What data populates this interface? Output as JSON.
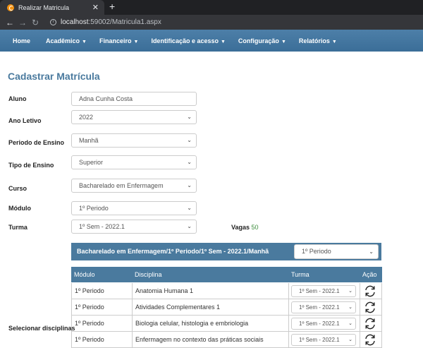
{
  "browser": {
    "tab_title": "Realizar Matricula",
    "url_host": "localhost",
    "url_rest": ":59002/Matricula1.aspx"
  },
  "nav": {
    "items": [
      "Home",
      "Acadêmico",
      "Financeiro",
      "Identificação e acesso",
      "Configuração",
      "Relatórios"
    ],
    "has_caret": [
      false,
      true,
      true,
      true,
      true,
      true
    ]
  },
  "page_title": "Cadastrar Matrícula",
  "form": {
    "aluno_label": "Aluno",
    "aluno_value": "Adna Cunha Costa",
    "ano_label": "Ano Letivo",
    "ano_value": "2022",
    "periodo_label": "Periodo de Ensino",
    "periodo_value": "Manhã",
    "tipo_label": "Tipo de Ensino",
    "tipo_value": "Superior",
    "curso_label": "Curso",
    "curso_value": "Bacharelado em Enfermagem",
    "modulo_label": "Módulo",
    "modulo_value": "1º Periodo",
    "turma_label": "Turma",
    "turma_value": "1º Sem - 2022.1",
    "vagas_label": "Vagas",
    "vagas_value": "50"
  },
  "band": {
    "text": "Bacharelado em Enfermagem/1º Periodo/1º Sem - 2022.1/Manhã",
    "select_value": "1º Periodo"
  },
  "table": {
    "headers": [
      "Módulo",
      "Disciplina",
      "Turma",
      "Ação"
    ],
    "rows": [
      {
        "modulo": "1º Periodo",
        "disciplina": "Anatomia Humana 1",
        "turma": "1º Sem - 2022.1"
      },
      {
        "modulo": "1º Periodo",
        "disciplina": "Atividades Complementares 1",
        "turma": "1º Sem - 2022.1"
      },
      {
        "modulo": "1º Periodo",
        "disciplina": "Biologia celular, histologia e embriologia",
        "turma": "1º Sem - 2022.1"
      },
      {
        "modulo": "1º Periodo",
        "disciplina": "Enfermagem no contexto das práticas sociais",
        "turma": "1º Sem - 2022.1"
      }
    ]
  },
  "selecionar_label": "Selecionar disciplinas",
  "colors": {
    "accent": "#4a7a9e",
    "vagas": "#3c8c3c"
  }
}
